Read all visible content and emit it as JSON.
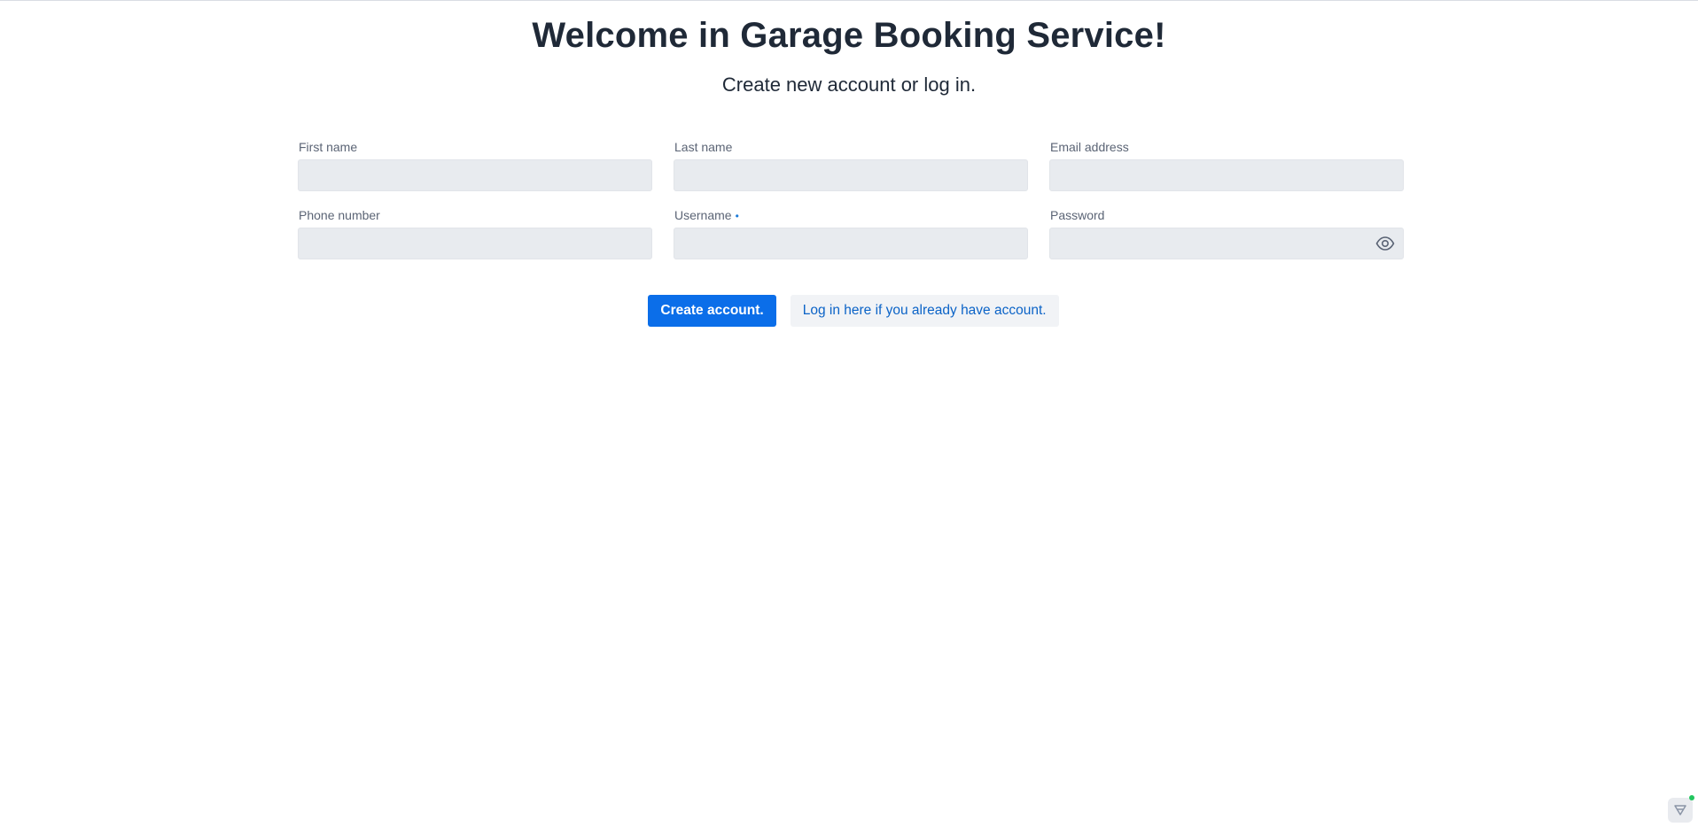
{
  "header": {
    "title": "Welcome in Garage Booking Service!",
    "subtitle": "Create new account or log in."
  },
  "form": {
    "first_name": {
      "label": "First name",
      "value": "",
      "placeholder": ""
    },
    "last_name": {
      "label": "Last name",
      "value": "",
      "placeholder": ""
    },
    "email": {
      "label": "Email address",
      "value": "",
      "placeholder": ""
    },
    "phone": {
      "label": "Phone number",
      "value": "",
      "placeholder": ""
    },
    "username": {
      "label": "Username",
      "required_marker": "•",
      "value": "",
      "placeholder": ""
    },
    "password": {
      "label": "Password",
      "value": "",
      "placeholder": "",
      "toggle_icon": "eye-icon"
    }
  },
  "actions": {
    "create_label": "Create account.",
    "login_label": "Log in here if you already have account."
  },
  "widget": {
    "icon": "feedback-icon",
    "status_color": "#22c55e"
  },
  "colors": {
    "primary": "#0b6ee9",
    "link": "#0b63c7",
    "input_bg": "#e8ebef",
    "text": "#1f2937"
  }
}
